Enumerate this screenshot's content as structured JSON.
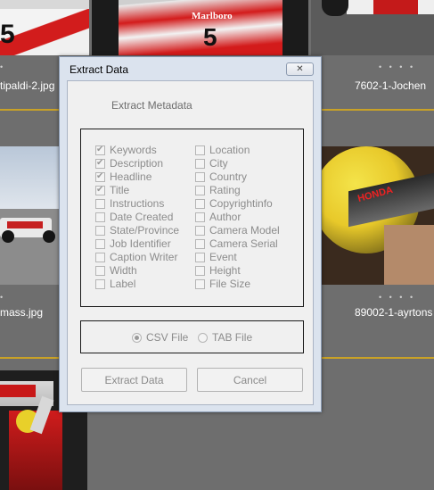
{
  "gallery": {
    "captions": {
      "top_left": "tipaldi-2.jpg",
      "top_right": "7602-1-Jochen",
      "mid_left": "mass.jpg",
      "mid_right": "89002-1-ayrtons"
    },
    "thumb_text": {
      "marlboro": "Marlboro",
      "car_number_left": "5",
      "car_number_center": "5",
      "honda": "HONDA"
    }
  },
  "dialog": {
    "title": "Extract Data",
    "close_glyph": "✕",
    "heading": "Extract Metadata",
    "fields_left": [
      {
        "label": "Keywords",
        "checked": true
      },
      {
        "label": "Description",
        "checked": true
      },
      {
        "label": "Headline",
        "checked": true
      },
      {
        "label": "Title",
        "checked": true
      },
      {
        "label": "Instructions",
        "checked": false
      },
      {
        "label": "Date Created",
        "checked": false
      },
      {
        "label": "State/Province",
        "checked": false
      },
      {
        "label": "Job Identifier",
        "checked": false
      },
      {
        "label": "Caption Writer",
        "checked": false
      },
      {
        "label": "Width",
        "checked": false
      },
      {
        "label": "Label",
        "checked": false
      }
    ],
    "fields_right": [
      {
        "label": "Location",
        "checked": false
      },
      {
        "label": "City",
        "checked": false
      },
      {
        "label": "Country",
        "checked": false
      },
      {
        "label": "Rating",
        "checked": false
      },
      {
        "label": "Copyrightinfo",
        "checked": false
      },
      {
        "label": "Author",
        "checked": false
      },
      {
        "label": "Camera Model",
        "checked": false
      },
      {
        "label": "Camera Serial",
        "checked": false
      },
      {
        "label": "Event",
        "checked": false
      },
      {
        "label": "Height",
        "checked": false
      },
      {
        "label": "File Size",
        "checked": false
      }
    ],
    "format": {
      "csv_label": "CSV File",
      "tab_label": "TAB File",
      "selected": "csv"
    },
    "buttons": {
      "extract": "Extract Data",
      "cancel": "Cancel"
    }
  }
}
